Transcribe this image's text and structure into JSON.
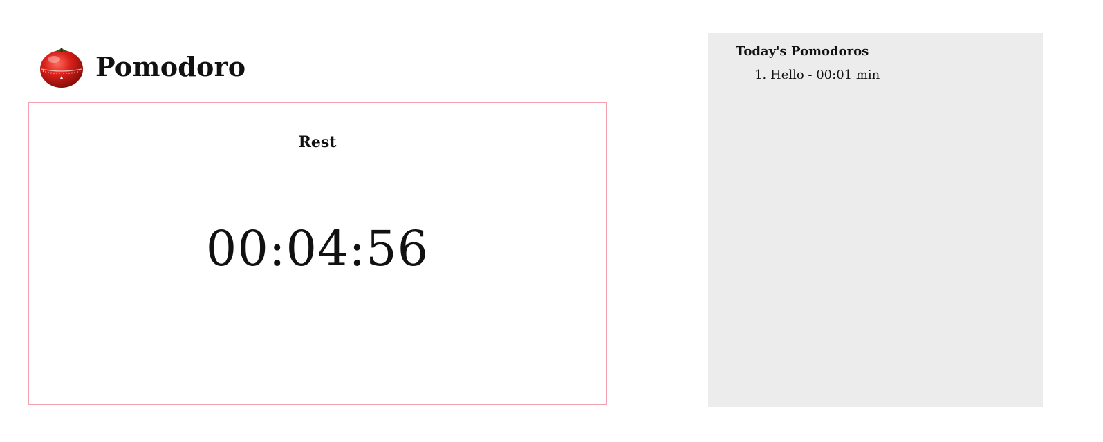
{
  "app": {
    "title": "Pomodoro",
    "logo_icon": "tomato-timer-icon"
  },
  "timer": {
    "phase": "Rest",
    "time": "00:04:56",
    "border_color": "#f3a1ae"
  },
  "history": {
    "title": "Today's Pomodoros",
    "items": [
      {
        "text": "Hello - 00:01 min"
      }
    ],
    "background": "#ececec"
  }
}
